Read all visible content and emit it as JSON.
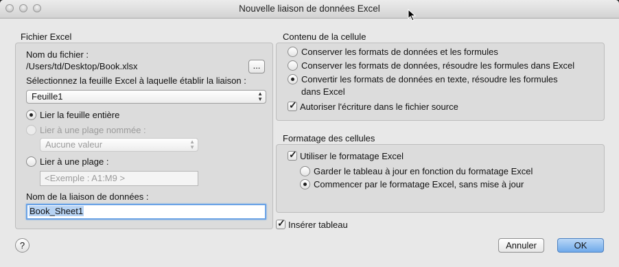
{
  "window": {
    "title": "Nouvelle liaison de données Excel"
  },
  "left": {
    "section_title": "Fichier Excel",
    "file_name_label": "Nom du fichier :",
    "file_path": "/Users/td/Desktop/Book.xlsx",
    "browse_label": "...",
    "sheet_label": "Sélectionnez la feuille Excel à laquelle établir la liaison :",
    "sheet_value": "Feuille1",
    "link_whole_sheet": "Lier la feuille entière",
    "link_named_range": "Lier à une plage nommée :",
    "named_range_value": "Aucune valeur",
    "link_range": "Lier à une plage :",
    "range_placeholder": "<Exemple : A1:M9 >",
    "link_name_label": "Nom de la liaison de données :",
    "link_name_value": "Book_Sheet1"
  },
  "cell_content": {
    "section_title": "Contenu de la cellule",
    "opt1": "Conserver les formats de données et les formules",
    "opt2": "Conserver les formats de données, résoudre les formules dans Excel",
    "opt3_line1": "Convertir les formats de données en texte, résoudre les formules",
    "opt3_line2": "dans Excel",
    "allow_write": "Autoriser l'écriture dans le fichier source"
  },
  "cell_format": {
    "section_title": "Formatage des cellules",
    "use_excel_format": "Utiliser le formatage Excel",
    "keep_updated": "Garder le tableau à jour en fonction du formatage Excel",
    "start_excel": "Commencer par le formatage Excel, sans mise à jour"
  },
  "insert_table": "Insérer tableau",
  "buttons": {
    "help": "?",
    "cancel": "Annuler",
    "ok": "OK"
  }
}
